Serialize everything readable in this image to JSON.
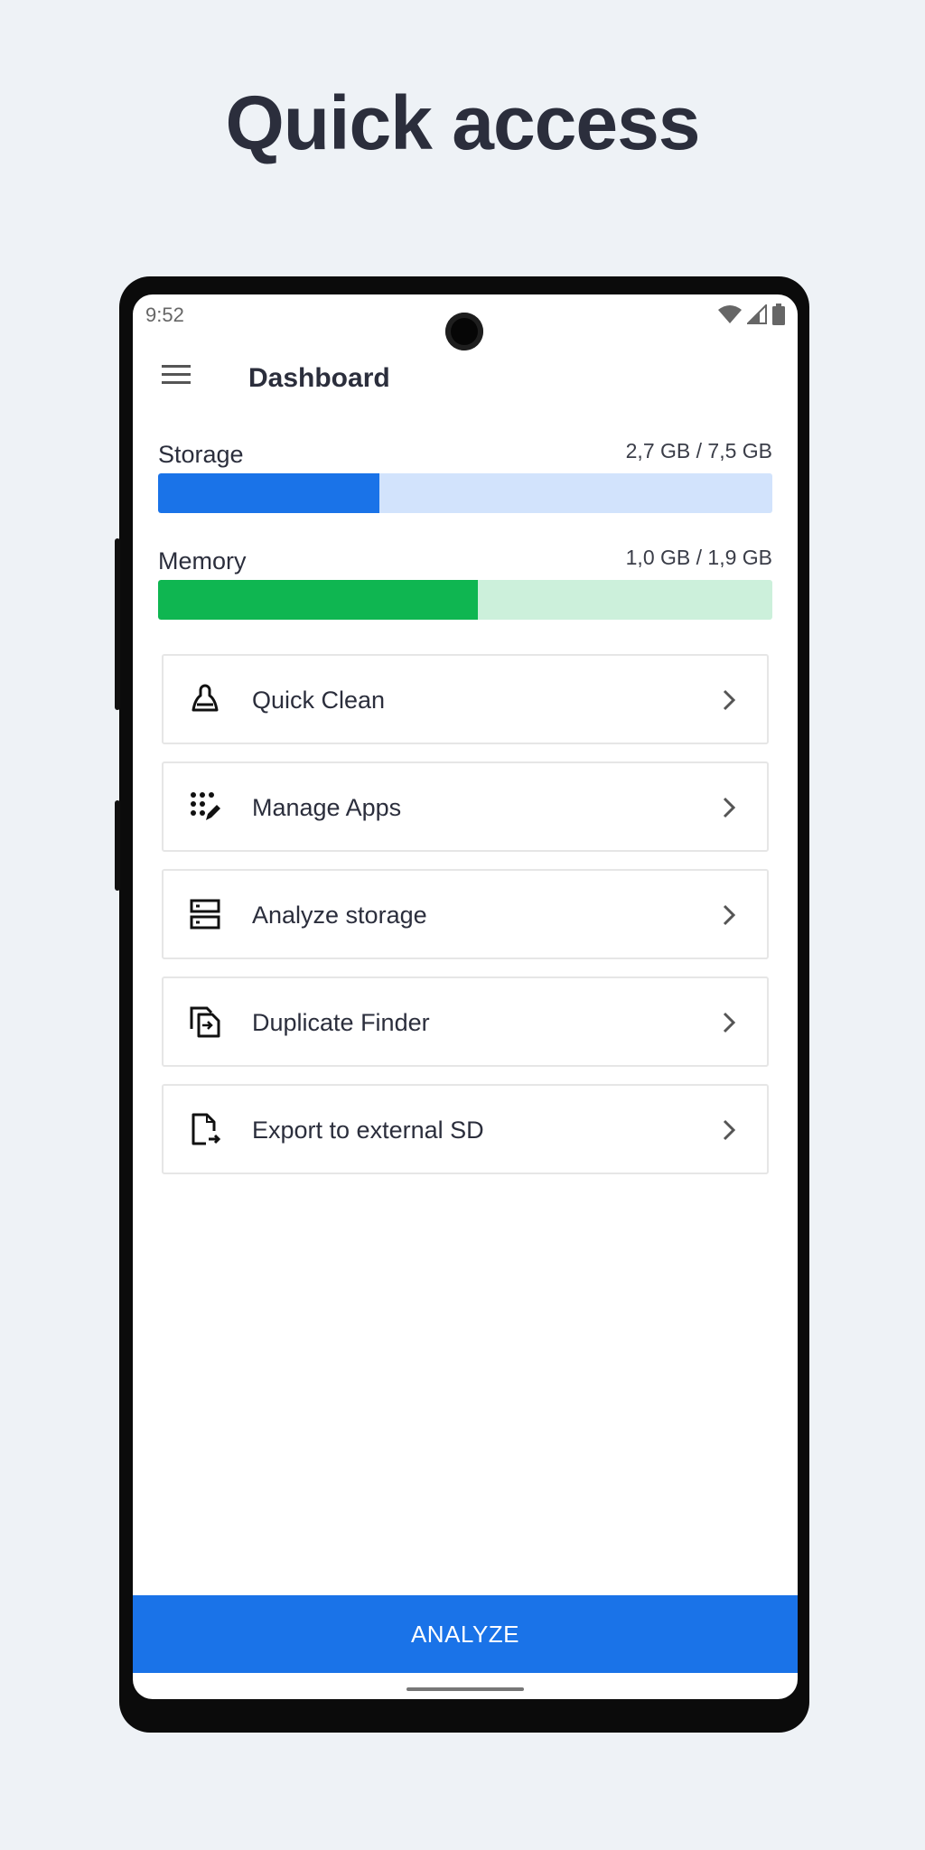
{
  "headline": "Quick access",
  "status": {
    "time": "9:52"
  },
  "appbar": {
    "title": "Dashboard",
    "menu_icon": "hamburger-menu-icon"
  },
  "meters": [
    {
      "label": "Storage",
      "value": "2,7 GB / 7,5 GB",
      "fill_fraction": 0.36,
      "fill_color": "#1a73e8",
      "track_color": "#d2e3fc"
    },
    {
      "label": "Memory",
      "value": "1,0 GB / 1,9 GB",
      "fill_fraction": 0.52,
      "fill_color": "#0fb651",
      "track_color": "#ccf0db"
    }
  ],
  "actions": [
    {
      "label": "Quick Clean",
      "icon": "broom-icon"
    },
    {
      "label": "Manage Apps",
      "icon": "apps-edit-icon"
    },
    {
      "label": "Analyze storage",
      "icon": "storage-icon"
    },
    {
      "label": "Duplicate Finder",
      "icon": "duplicate-icon"
    },
    {
      "label": "Export to external SD",
      "icon": "export-file-icon"
    }
  ],
  "analyze_button": "ANALYZE",
  "colors": {
    "accent": "#1a73e8",
    "memory": "#0fb651",
    "text": "#2b2e3c"
  }
}
